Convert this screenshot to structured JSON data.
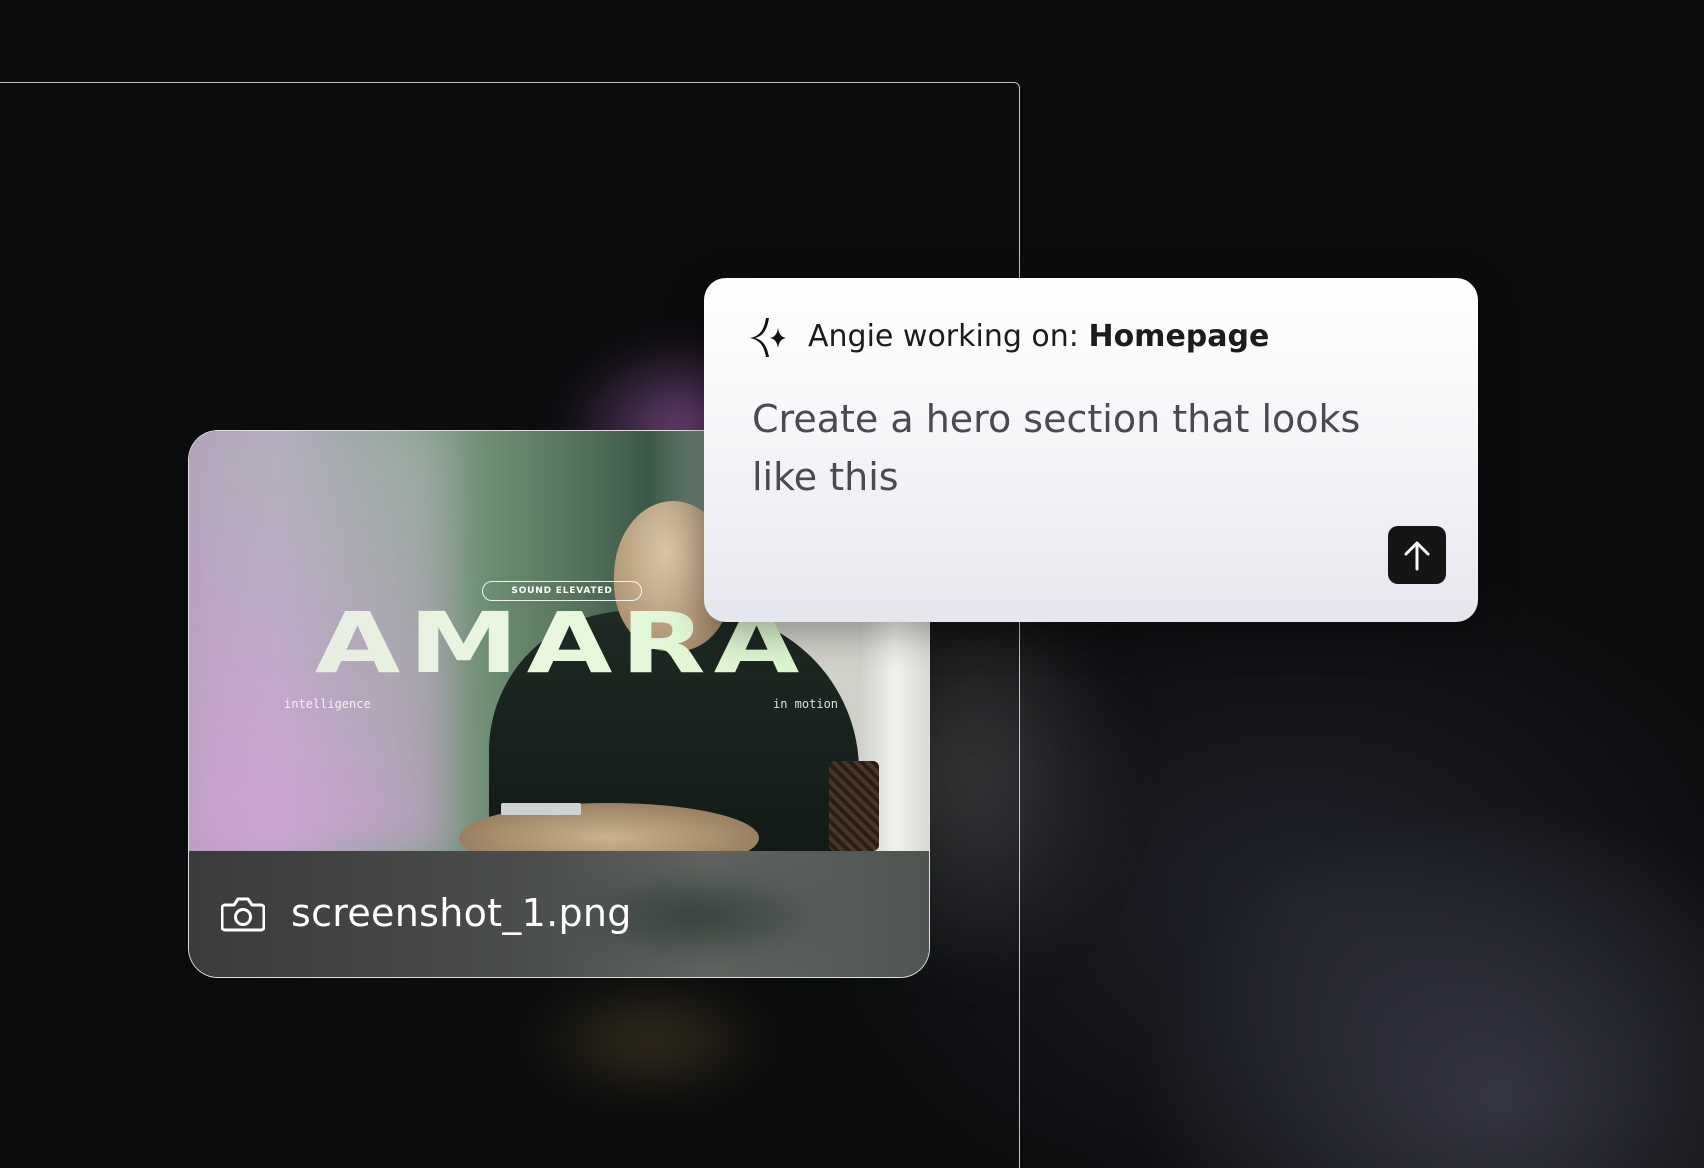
{
  "agent": {
    "working_prefix": "Angie working on:",
    "page_name": "Homepage",
    "icon": "sparkle-icon"
  },
  "prompt": {
    "text": "Create a hero section that looks like this"
  },
  "send_button": {
    "icon": "arrow-up-icon"
  },
  "attachment": {
    "file_name": "screenshot_1.png",
    "icon": "camera-icon",
    "preview": {
      "badge": "SOUND ELEVATED",
      "brand": "AMARA",
      "tag_left": "intelligence",
      "tag_right": "in motion"
    }
  },
  "colors": {
    "background": "#0b0c0d",
    "card": "#ffffff",
    "send_button": "#151515",
    "brand_green": "#d7f7c8"
  }
}
